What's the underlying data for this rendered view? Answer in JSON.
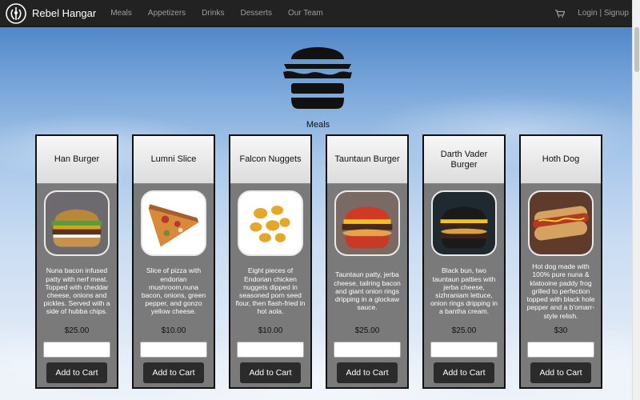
{
  "navbar": {
    "brand": "Rebel Hangar",
    "links": [
      "Meals",
      "Appetizers",
      "Drinks",
      "Desserts",
      "Our Team"
    ],
    "login": "Login",
    "separator": " | ",
    "signup": "Signup"
  },
  "section_title": "Meals",
  "add_to_cart_label": "Add to Cart",
  "cards": [
    {
      "name": "Han Burger",
      "desc": "Nuna bacon infused patty with nerf meat. Topped with cheddar cheese, onions and pickles. Served with a side of hubba chips.",
      "price": "$25.00",
      "image": "burger-photo"
    },
    {
      "name": "Lumni Slice",
      "desc": "Slice of pizza with endorian mushroom,nuna bacon, onions, green pepper, and gonzo yellow cheese.",
      "price": "$10.00",
      "image": "pizza-photo"
    },
    {
      "name": "Falcon Nuggets",
      "desc": "Eight pieces of Endorian chicken nuggets dipped in seasoned porn seed flour, then flash-fried in hot aola.",
      "price": "$10.00",
      "image": "nuggets-photo"
    },
    {
      "name": "Tauntaun Burger",
      "desc": "Tauntaun patty, jerba cheese, tailring bacon and giant onion rings dripping in a glockaw sauce.",
      "price": "$25.00",
      "image": "red-burger-photo"
    },
    {
      "name": "Darth Vader Burger",
      "desc": "Black bun, two tauntaun patties with jerba cheese, sizhraniam lettuce, onion rings dripping in a bantha cream.",
      "price": "$25.00",
      "image": "black-burger-photo"
    },
    {
      "name": "Hoth Dog",
      "desc": "Hot dog made with 100% pure nuna & klatooine paddy frog grilled to perfection topped with black hole pepper and a b'omarr-style relish.",
      "price": "$30",
      "image": "hotdog-photo"
    }
  ]
}
